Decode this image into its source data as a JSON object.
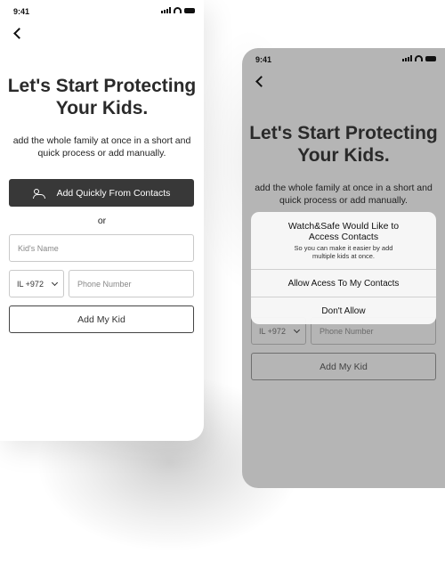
{
  "status": {
    "time": "9:41"
  },
  "screen": {
    "title_line1": "Let's Start Protecting",
    "title_line2": "Your Kids.",
    "subtitle_line1": "add the whole family at once in a short and",
    "subtitle_line2": "quick process or add manually.",
    "contacts_button": "Add Quickly From Contacts",
    "or_text": "or",
    "kid_name_placeholder": "Kid's Name",
    "country_code": "IL +972",
    "phone_placeholder": "Phone Number",
    "add_kid_button": "Add My Kid"
  },
  "dialog": {
    "title_line1": "Watch&Safe Would Like to",
    "title_line2": "Access Contacts",
    "text_line1": "So you can make it easier by add",
    "text_line2": "multiple kids at once.",
    "allow_button": "Allow Acess To My Contacts",
    "deny_button": "Don't Allow"
  },
  "colors": {
    "primary_button": "#383838",
    "overlay": "#b5b5b5"
  },
  "icons": [
    "back-arrow-icon",
    "contacts-icon",
    "chevron-down-icon",
    "signal-icon",
    "wifi-icon",
    "battery-icon"
  ]
}
